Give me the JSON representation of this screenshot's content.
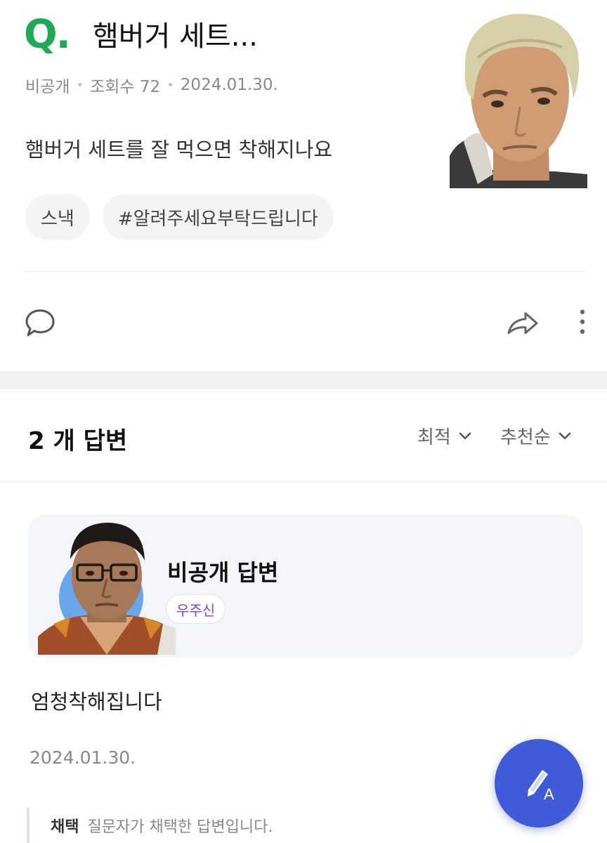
{
  "question": {
    "mark": "Q.",
    "title": "햄버거 세트...",
    "meta": {
      "visibility": "비공개",
      "views": "조회수 72",
      "date": "2024.01.30."
    },
    "body": "햄버거 세트를 잘 먹으면 착해지나요",
    "tags": [
      "스낵",
      "#알려주세요부탁드립니다"
    ],
    "accent_color": "#1fa955"
  },
  "actions": {
    "comment_icon": "comment-bubble-icon",
    "share_icon": "share-arrow-icon",
    "more_icon": "more-vertical-icon"
  },
  "answers": {
    "count_label": "2 개 답변",
    "sort_options": [
      "최적",
      "추천순"
    ]
  },
  "answer": {
    "author_name": "비공개 답변",
    "badge": "우주신",
    "text": "엄청착해집니다",
    "date": "2024.01.30.",
    "adopted_label": "채택",
    "adopted_text": "질문자가 채택한 답변입니다."
  },
  "fab": {
    "icon": "write-answer-icon",
    "letter": "A",
    "color": "#3f5bd7"
  }
}
